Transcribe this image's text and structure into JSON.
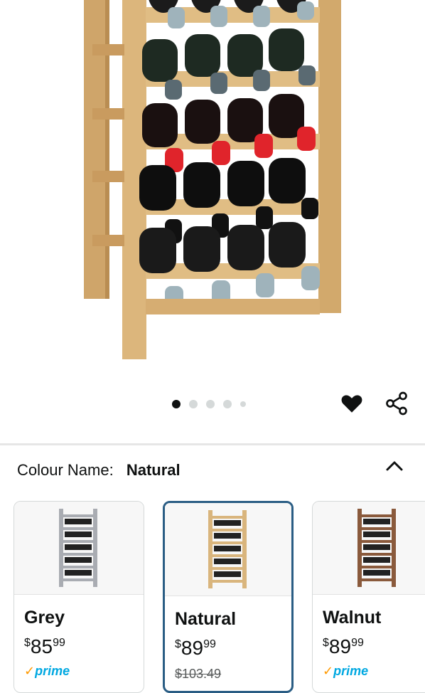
{
  "gallery": {
    "product_image": "bamboo-wine-rack-natural",
    "page_count": 5,
    "active_page": 1
  },
  "actions": {
    "favorite_icon": "heart-icon",
    "share_icon": "share-icon"
  },
  "variation": {
    "label": "Colour Name:",
    "selected_value": "Natural",
    "collapse_icon": "chevron-up-icon",
    "options": [
      {
        "name": "Grey",
        "currency": "$",
        "whole": "85",
        "fraction": "99",
        "list_price": "",
        "prime": "prime",
        "thumb_color": "#a9acb2"
      },
      {
        "name": "Natural",
        "currency": "$",
        "whole": "89",
        "fraction": "99",
        "list_price": "$103.49",
        "prime": "",
        "thumb_color": "#d9b57d"
      },
      {
        "name": "Walnut",
        "currency": "$",
        "whole": "89",
        "fraction": "99",
        "list_price": "",
        "prime": "prime",
        "thumb_color": "#8a5a3c"
      }
    ]
  },
  "colors": {
    "accent": "#2a5d84",
    "prime": "#00a8e1",
    "prime_check": "#ff9900",
    "wood": "#d9b57d"
  }
}
